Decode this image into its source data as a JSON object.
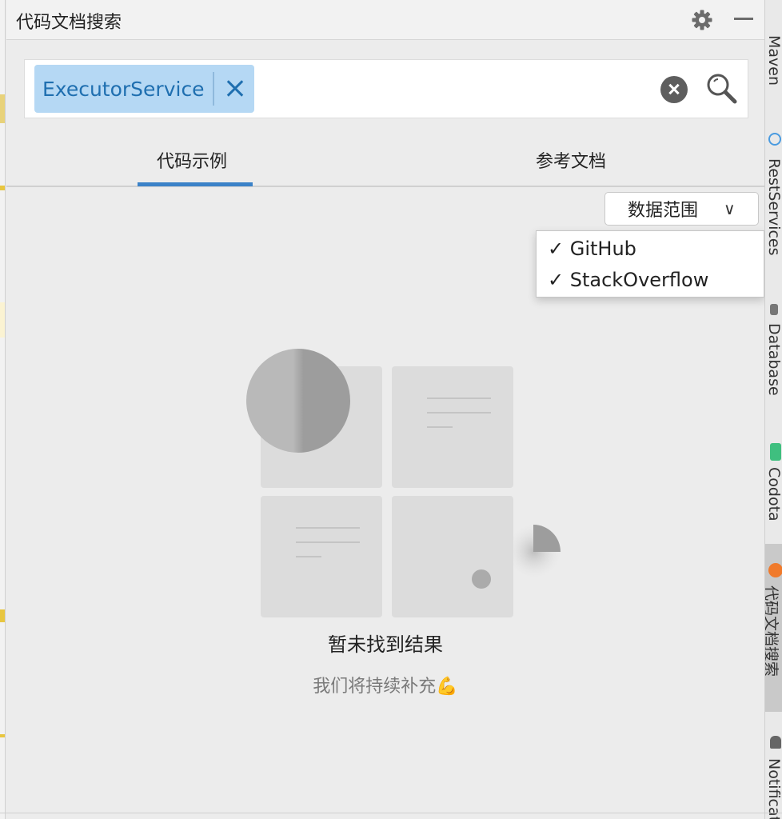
{
  "panel": {
    "title": "代码文档搜索"
  },
  "search": {
    "chip_label": "ExecutorService"
  },
  "tabs": [
    {
      "label": "代码示例",
      "active": true
    },
    {
      "label": "参考文档",
      "active": false
    }
  ],
  "scope": {
    "label": "数据范围",
    "caret": "∨",
    "options": [
      {
        "label": "✓ GitHub",
        "checked": true
      },
      {
        "label": "✓ StackOverflow",
        "checked": true
      }
    ]
  },
  "empty_state": {
    "title": "暂未找到结果",
    "subtitle": "我们将持续补充💪"
  },
  "right_toolbar": [
    {
      "label": "Maven",
      "icon": "maven-icon"
    },
    {
      "label": "RestServices",
      "icon": "rest-services-icon"
    },
    {
      "label": "Database",
      "icon": "database-icon"
    },
    {
      "label": "Codota",
      "icon": "codota-icon"
    },
    {
      "label": "代码文档搜索",
      "icon": "code-doc-search-icon",
      "active": true
    },
    {
      "label": "Notifications",
      "icon": "notifications-icon"
    }
  ],
  "colors": {
    "accent": "#3b82c8",
    "chip_bg": "#b5d8f4",
    "chip_text": "#1f6fb0",
    "panel_bg": "#ececec"
  }
}
